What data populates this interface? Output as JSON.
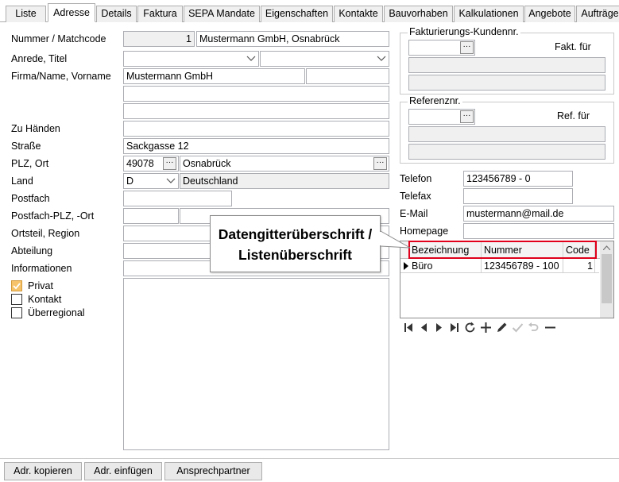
{
  "tabs": [
    "Liste",
    "Adresse",
    "Details",
    "Faktura",
    "SEPA Mandate",
    "Eigenschaften",
    "Kontakte",
    "Bauvorhaben",
    "Kalkulationen",
    "Angebote",
    "Aufträge"
  ],
  "active_tab": "Adresse",
  "labels": {
    "nummer": "Nummer / Matchcode",
    "anrede": "Anrede, Titel",
    "firma": "Firma/Name, Vorname",
    "zuhaenden": "Zu Händen",
    "strasse": "Straße",
    "plz": "PLZ, Ort",
    "land": "Land",
    "postfach": "Postfach",
    "postfach_plz": "Postfach-PLZ, -Ort",
    "ortsteil": "Ortsteil, Region",
    "abteilung": "Abteilung",
    "informationen": "Informationen"
  },
  "fields": {
    "nummer": "1",
    "matchcode": "Mustermann GmbH, Osnabrück",
    "anrede": "",
    "titel": "",
    "firma": "Mustermann GmbH",
    "vorname": "",
    "name2": "",
    "name3": "",
    "zuhaenden": "",
    "strasse": "Sackgasse 12",
    "plz": "49078",
    "ort": "Osnabrück",
    "land_code": "D",
    "land_name": "Deutschland",
    "postfach": "",
    "postfach_plz": "",
    "postfach_ort": "",
    "ortsteil": "",
    "abteilung": "",
    "informationen": ""
  },
  "checkboxes": [
    {
      "label": "Privat",
      "checked": true
    },
    {
      "label": "Kontakt",
      "checked": false
    },
    {
      "label": "Überregional",
      "checked": false
    }
  ],
  "fakturierung": {
    "title": "Fakturierungs-Kundennr.",
    "fakt_label": "Fakt. für",
    "value": ""
  },
  "referenz": {
    "title": "Referenznr.",
    "ref_label": "Ref. für",
    "value": ""
  },
  "contact": {
    "telefon_label": "Telefon",
    "telefon": "123456789 - 0",
    "telefax_label": "Telefax",
    "telefax": "",
    "email_label": "E-Mail",
    "email": "mustermann@mail.de",
    "homepage_label": "Homepage",
    "homepage": ""
  },
  "grid": {
    "columns": [
      "Bezeichnung",
      "Nummer",
      "Code"
    ],
    "rows": [
      {
        "bezeichnung": "Büro",
        "nummer": "123456789 - 100",
        "code": "1"
      }
    ]
  },
  "callout": {
    "line1": "Datengitterüberschrift /",
    "line2": "Listenüberschrift"
  },
  "buttons": {
    "kopieren": "Adr. kopieren",
    "einfuegen": "Adr. einfügen",
    "ansprechpartner": "Ansprechpartner"
  },
  "colors": {
    "highlight": "#e0001b",
    "checkbox_checked": "#f7c36a"
  }
}
